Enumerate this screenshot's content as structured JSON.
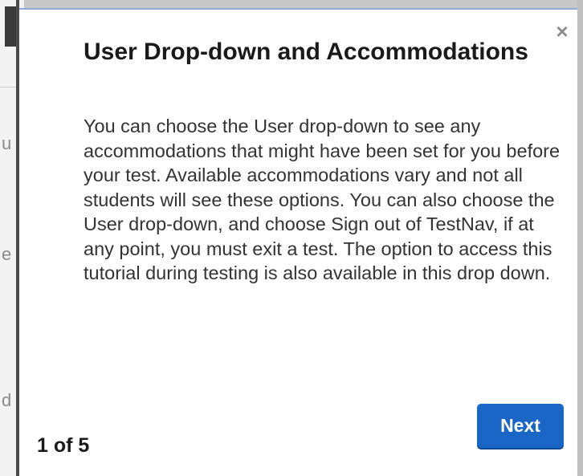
{
  "background": {
    "glyphs": [
      "u",
      "e",
      "d"
    ]
  },
  "dialog": {
    "close_glyph": "×",
    "close_icon": "close-icon",
    "title": "User Drop-down and Accommodations",
    "body": "You can choose the User drop-down to see any accommodations that might have been set for you before your test. Available accommodations vary and not all students will see these options. You can also choose the User drop-down, and choose Sign out of TestNav, if at any point, you must exit a test. The option to access this tutorial during testing is also available in this drop down.",
    "step_counter": "1 of 5",
    "next_label": "Next"
  },
  "colors": {
    "primary_button": "#1a66c6",
    "dialog_background": "#ffffff",
    "overlay": "#c8c8c8"
  }
}
